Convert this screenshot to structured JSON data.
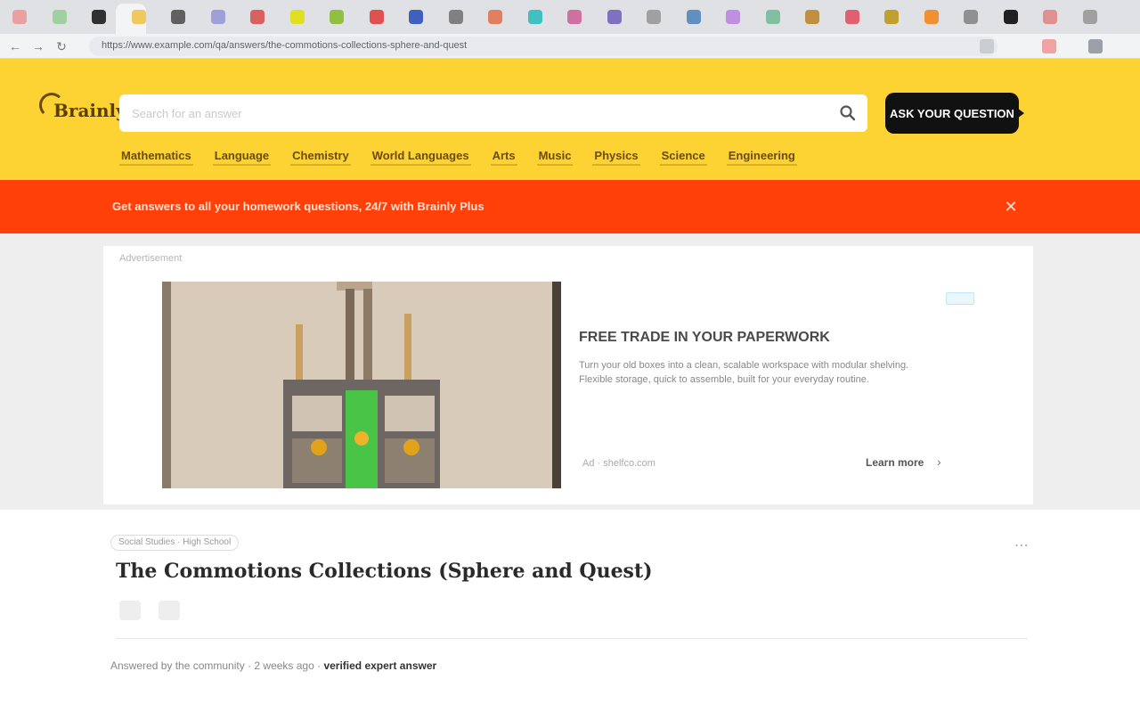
{
  "browser": {
    "url": "https://www.example.com/qa/answers/the-commotions-collections-sphere-and-quest",
    "extensions": [
      "extension-icon",
      "extension-icon",
      "extension-icon"
    ]
  },
  "header": {
    "logo_text": "Brainly",
    "search_placeholder": "Search for an answer",
    "cta_label": "ASK YOUR QUESTION",
    "nav": [
      "Mathematics",
      "Language",
      "Chemistry",
      "World Languages",
      "Arts",
      "Music",
      "Physics",
      "Science",
      "Engineering"
    ]
  },
  "promo": {
    "text": "Get answers to all your homework questions, 24/7 with Brainly Plus",
    "close_icon": "close-icon"
  },
  "ad": {
    "label": "Advertisement",
    "title": "FREE TRADE IN YOUR PAPERWORK",
    "body": "Turn your old boxes into a clean, scalable workspace with modular shelving. Flexible storage, quick to assemble, built for your everyday routine.",
    "domain": "Ad · shelfco.com",
    "more_label": "Learn more"
  },
  "article": {
    "category": "Social Studies · High School",
    "title": "The Commotions Collections (Sphere and Quest)",
    "byline_prefix": "Answered by the community · 2 weeks ago · ",
    "byline_name": "verified expert answer"
  },
  "colors": {
    "header_yellow": "#fdd233",
    "promo_orange": "#ff4008",
    "cta_black": "#111111"
  }
}
